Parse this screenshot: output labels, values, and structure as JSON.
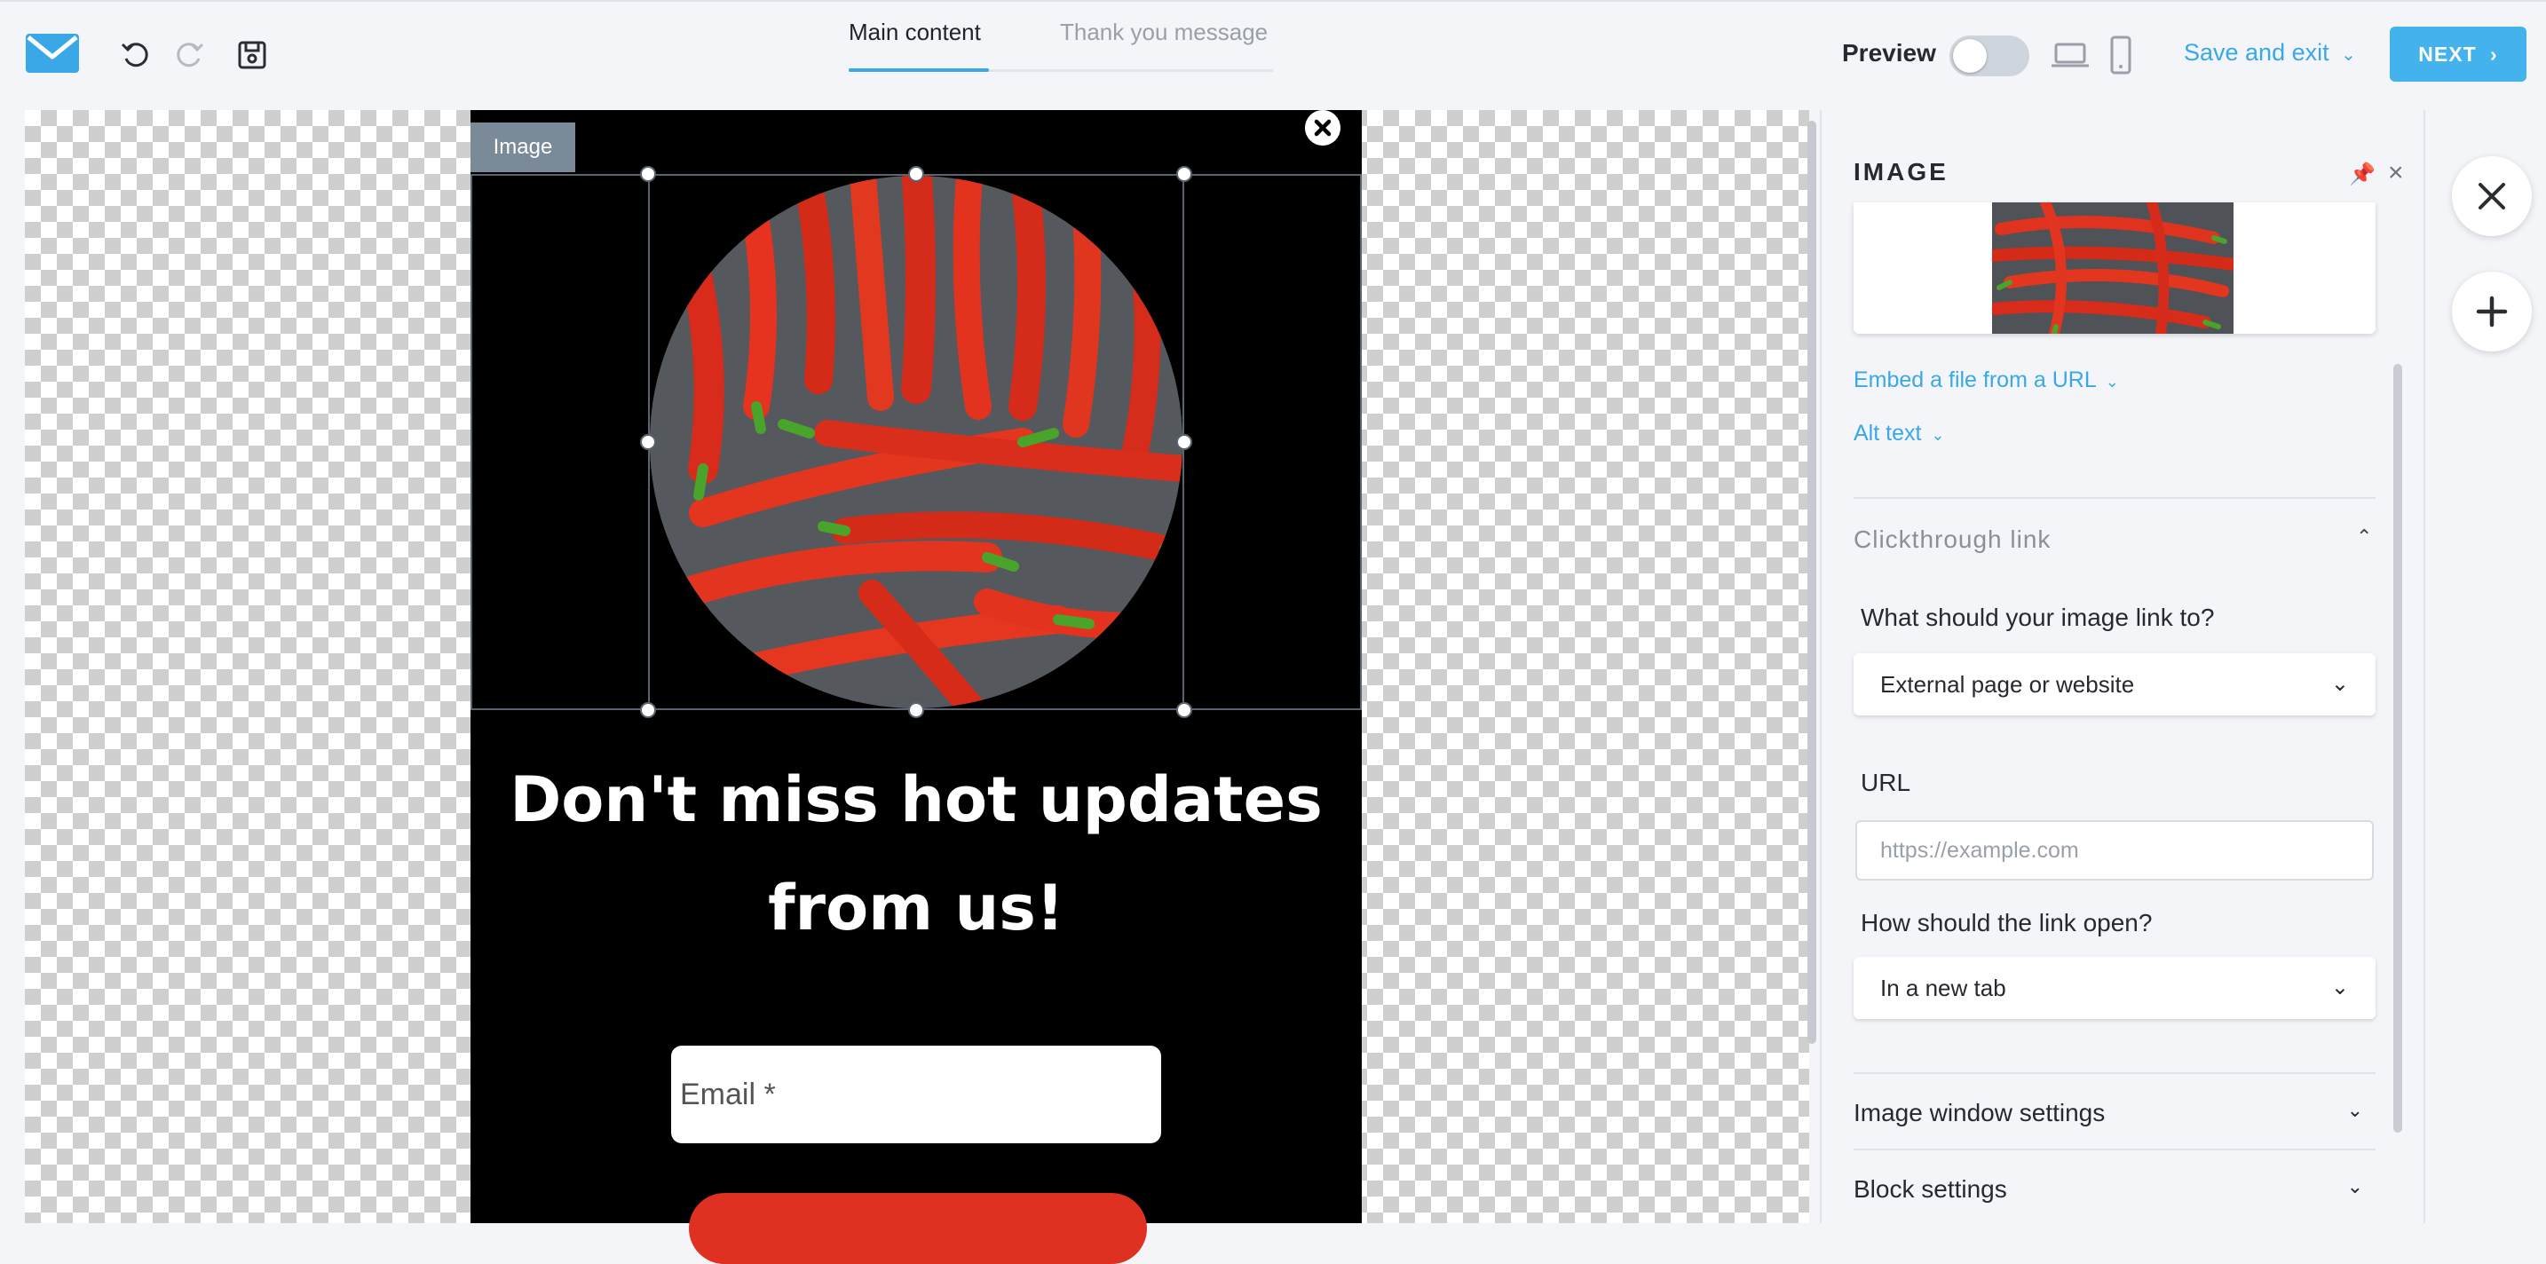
{
  "header": {
    "tabs": [
      {
        "label": "Main content",
        "active": true
      },
      {
        "label": "Thank you message",
        "active": false
      }
    ],
    "preview_label": "Preview",
    "preview_enabled": false,
    "save_exit_label": "Save and exit",
    "next_label": "NEXT",
    "icons": [
      "logo-envelope-icon",
      "undo-icon",
      "redo-icon",
      "save-icon",
      "laptop-icon",
      "mobile-icon",
      "chevron-down-icon",
      "chevron-right-icon"
    ],
    "accent_color": "#3aa8e6"
  },
  "canvas": {
    "image_tag": "Image",
    "headline": "Don't miss hot updates from us!",
    "email_placeholder": "Email *",
    "popup_background": "#000000",
    "button_color": "#de3121"
  },
  "panel": {
    "title": "IMAGE",
    "embed_link": "Embed a file from a URL",
    "alt_text_link": "Alt text",
    "clickthrough_title": "Clickthrough link",
    "link_question": "What should your image link to?",
    "link_target_value": "External page or website",
    "url_label": "URL",
    "url_placeholder": "https://example.com",
    "open_question": "How should the link open?",
    "open_value": "In a new tab",
    "sections": [
      "Image window settings",
      "Block settings"
    ]
  }
}
